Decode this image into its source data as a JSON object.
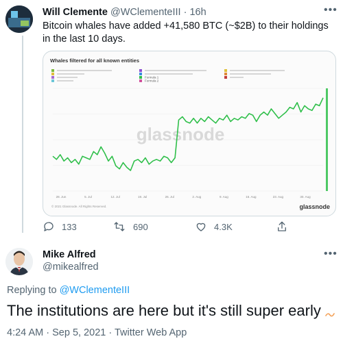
{
  "tweet": {
    "author_name": "Will Clemente",
    "handle": "@WClementeIII",
    "separator": "·",
    "time": "16h",
    "text": "Bitcoin whales have added +41,580 BTC (~$2B) to their holdings in the last 10 days.",
    "more_icon": "more-horizontal-icon",
    "stats": {
      "replies": "133",
      "retweets": "690",
      "likes": "4.3K"
    }
  },
  "chart": {
    "title": "Whales filtered for all known entities",
    "watermark": "glassnode",
    "copyright": "© 2021 Glassnode. All Rights Reserved.",
    "brand": "glassnode",
    "legend_formula_1": "Formula 1",
    "legend_formula_2": "Formula 2"
  },
  "chart_data": {
    "type": "line",
    "title": "Whales filtered for all known entities",
    "x_tick_labels": [
      "28. Jun",
      "5. Jul",
      "12. Jul",
      "19. Jul",
      "26. Jul",
      "2. Aug",
      "9. Aug",
      "16. Aug",
      "23. Aug",
      "30. Aug"
    ],
    "series": [
      {
        "color": "#2fbf4a",
        "values": [
          52,
          50,
          53,
          49,
          51,
          48,
          50,
          47,
          52,
          51,
          50,
          55,
          53,
          58,
          54,
          49,
          52,
          46,
          44,
          48,
          45,
          43,
          49,
          50,
          48,
          51,
          47,
          49,
          50,
          49,
          52,
          51,
          48,
          51,
          75,
          77,
          74,
          73,
          76,
          73,
          76,
          74,
          77,
          75,
          73,
          76,
          75,
          78,
          74,
          76,
          75,
          77,
          76,
          79,
          78,
          74,
          78,
          80,
          78,
          82,
          79,
          76,
          78,
          80,
          83,
          82,
          86,
          80,
          84,
          82,
          81,
          85,
          84,
          89
        ]
      }
    ],
    "grid": true,
    "legend_placement": "top-left"
  },
  "reply": {
    "author_name": "Mike Alfred",
    "handle": "@mikealfred",
    "replying_prefix": "Replying to",
    "replying_to": "@WClementeIII",
    "text": "The institutions are here but it's still super early",
    "timestamp": "4:24 AM",
    "date": "Sep 5, 2021",
    "client": "Twitter Web App",
    "separator": "·"
  },
  "colors": {
    "accent": "#1d9bf0",
    "line": "#2fbf4a",
    "muted": "#536471"
  }
}
